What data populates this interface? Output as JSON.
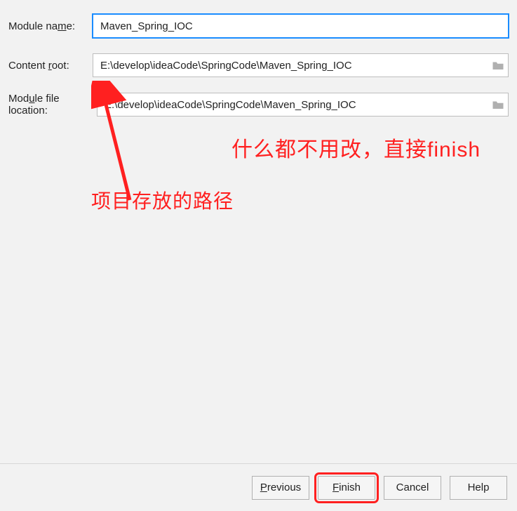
{
  "form": {
    "moduleName": {
      "labelPre": "Module na",
      "labelU": "m",
      "labelPost": "e:",
      "value": "Maven_Spring_IOC"
    },
    "contentRoot": {
      "labelPre": "Content ",
      "labelU": "r",
      "labelPost": "oot:",
      "value": "E:\\develop\\ideaCode\\SpringCode\\Maven_Spring_IOC"
    },
    "moduleFileLocation": {
      "labelPre": "Mod",
      "labelU": "u",
      "labelPost": "le file location:",
      "value": "E:\\develop\\ideaCode\\SpringCode\\Maven_Spring_IOC"
    }
  },
  "buttons": {
    "previous": {
      "u": "P",
      "rest": "revious"
    },
    "finish": {
      "u": "F",
      "rest": "inish"
    },
    "cancel": {
      "text": "Cancel"
    },
    "help": {
      "text": "Help"
    }
  },
  "annotations": {
    "big": "什么都不用改，直接finish",
    "mid": "项目存放的路径"
  }
}
